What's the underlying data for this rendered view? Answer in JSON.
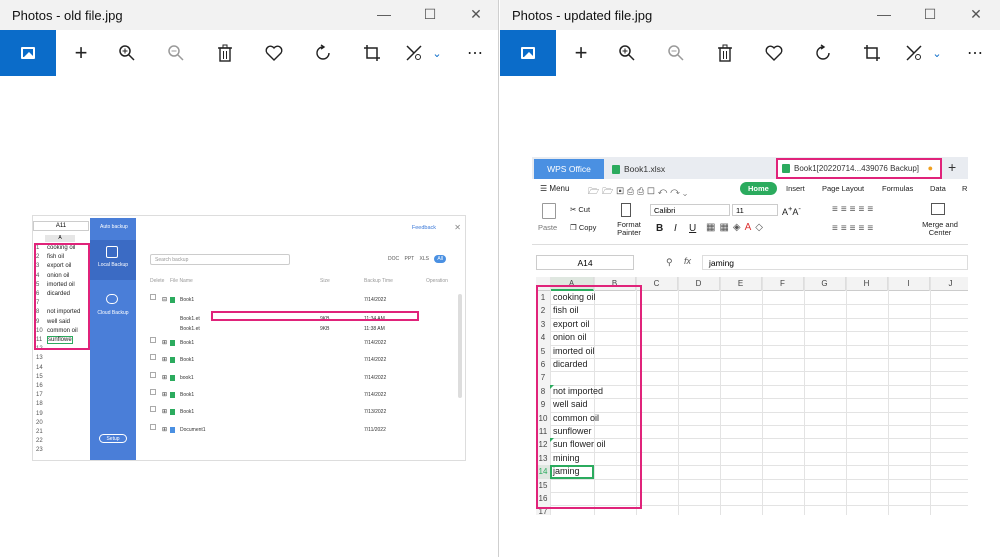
{
  "left_window": {
    "title": "Photos - old file.jpg",
    "toolbar_icons": [
      "image-icon",
      "add-icon",
      "zoom-in-icon",
      "zoom-out-icon",
      "delete-icon",
      "heart-icon",
      "rotate-icon",
      "crop-icon",
      "edit-icon",
      "more-icon"
    ],
    "screenshot": {
      "cell_ref": "A11",
      "col_a": "A",
      "rows": [
        {
          "n": "1",
          "v": "cooking oil"
        },
        {
          "n": "2",
          "v": "fish oil"
        },
        {
          "n": "3",
          "v": "export oil"
        },
        {
          "n": "4",
          "v": "onion oil"
        },
        {
          "n": "5",
          "v": "imorted oil"
        },
        {
          "n": "6",
          "v": "dicarded"
        },
        {
          "n": "7",
          "v": ""
        },
        {
          "n": "8",
          "v": "not imported"
        },
        {
          "n": "9",
          "v": "well said"
        },
        {
          "n": "10",
          "v": "common oil"
        },
        {
          "n": "11",
          "v": "sunflowe"
        },
        {
          "n": "12",
          "v": ""
        },
        {
          "n": "13",
          "v": ""
        },
        {
          "n": "14",
          "v": ""
        },
        {
          "n": "15",
          "v": ""
        },
        {
          "n": "16",
          "v": ""
        },
        {
          "n": "17",
          "v": ""
        },
        {
          "n": "18",
          "v": ""
        },
        {
          "n": "19",
          "v": ""
        },
        {
          "n": "20",
          "v": ""
        },
        {
          "n": "21",
          "v": ""
        },
        {
          "n": "22",
          "v": ""
        },
        {
          "n": "23",
          "v": ""
        }
      ],
      "backup": {
        "auto_backup": "Auto backup",
        "local_backup": "Local Backup",
        "cloud_backup": "Cloud Backup",
        "setup": "Setup",
        "feedback": "Feedback",
        "search_placeholder": "Search backup",
        "filters": [
          "DOC",
          "PPT",
          "XLS",
          "All"
        ],
        "headers": {
          "delete": "Delete",
          "file_name": "File Name",
          "size": "Size",
          "backup_time": "Backup Time",
          "operation": "Operation"
        },
        "rows": [
          {
            "name": "Book1",
            "size": "",
            "time": "7/14/2022"
          },
          {
            "name": "Book1.et",
            "size": "9KB",
            "time": "11:34 AM"
          },
          {
            "name": "Book1.et",
            "size": "9KB",
            "time": "11:38 AM"
          },
          {
            "name": "Book1",
            "size": "",
            "time": "7/14/2022"
          },
          {
            "name": "Book1",
            "size": "",
            "time": "7/14/2022"
          },
          {
            "name": "book1",
            "size": "",
            "time": "7/14/2022"
          },
          {
            "name": "Book1",
            "size": "",
            "time": "7/14/2022"
          },
          {
            "name": "Book1",
            "size": "",
            "time": "7/13/2022"
          },
          {
            "name": "Document1",
            "size": "",
            "time": "7/11/2022"
          }
        ]
      }
    }
  },
  "right_window": {
    "title": "Photos - updated file.jpg",
    "screenshot": {
      "tabs": {
        "wps": "WPS Office",
        "book": "Book1.xlsx",
        "backup": "Book1[20220714...439076 Backup]",
        "plus": "+"
      },
      "menu": {
        "menu": "Menu",
        "home": "Home",
        "insert": "Insert",
        "page_layout": "Page Layout",
        "formulas": "Formulas",
        "data": "Data",
        "r": "R"
      },
      "ribbon": {
        "paste": "Paste",
        "cut": "Cut",
        "copy": "Copy",
        "format_painter": "Format Painter",
        "font": "Calibri",
        "size": "11",
        "bold": "B",
        "italic": "I",
        "underline": "U",
        "merge": "Merge and Center"
      },
      "name_box": "A14",
      "fx": "fx",
      "formula": "jaming",
      "columns": [
        "A",
        "B",
        "C",
        "D",
        "E",
        "F",
        "G",
        "H",
        "I",
        "J"
      ],
      "rows": [
        {
          "n": "1",
          "v": "cooking oil"
        },
        {
          "n": "2",
          "v": "fish oil"
        },
        {
          "n": "3",
          "v": "export oil"
        },
        {
          "n": "4",
          "v": "onion oil"
        },
        {
          "n": "5",
          "v": "imorted oil"
        },
        {
          "n": "6",
          "v": "dicarded"
        },
        {
          "n": "7",
          "v": ""
        },
        {
          "n": "8",
          "v": "not imported"
        },
        {
          "n": "9",
          "v": "well said"
        },
        {
          "n": "10",
          "v": "common oil"
        },
        {
          "n": "11",
          "v": "sunflower"
        },
        {
          "n": "12",
          "v": "sun flower oil"
        },
        {
          "n": "13",
          "v": "mining"
        },
        {
          "n": "14",
          "v": "jaming"
        },
        {
          "n": "15",
          "v": ""
        },
        {
          "n": "16",
          "v": ""
        },
        {
          "n": "17",
          "v": ""
        }
      ]
    }
  },
  "colors": {
    "accent": "#0b6cc9",
    "highlight": "#e0237a",
    "wps_green": "#2bab5e",
    "wps_blue": "#4a90e2"
  }
}
